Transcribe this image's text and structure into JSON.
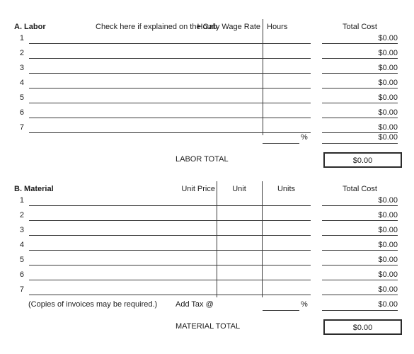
{
  "form": {
    "background_color": "#ffffff",
    "rule_color": "#3a3a3a",
    "box_border_color": "#2b2b2b",
    "text_color": "#1d1d1d"
  },
  "labor": {
    "section_title": "A. Labor",
    "check_note": "Check here if explained on the Cab",
    "columns": {
      "hourly_wage_rate": "Hourly Wage Rate",
      "hours": "Hours",
      "total_cost": "Total Cost"
    },
    "row_numbers": [
      "1",
      "2",
      "3",
      "4",
      "5",
      "6",
      "7"
    ],
    "total_costs": [
      "$0.00",
      "$0.00",
      "$0.00",
      "$0.00",
      "$0.00",
      "$0.00",
      "$0.00"
    ],
    "percent_symbol": "%",
    "percent_row_total": "$0.00",
    "total_label": "LABOR TOTAL",
    "total_value": "$0.00"
  },
  "material": {
    "section_title": "B. Material",
    "columns": {
      "unit_price": "Unit Price",
      "unit": "Unit",
      "units": "Units",
      "total_cost": "Total Cost"
    },
    "row_numbers": [
      "1",
      "2",
      "3",
      "4",
      "5",
      "6",
      "7"
    ],
    "total_costs": [
      "$0.00",
      "$0.00",
      "$0.00",
      "$0.00",
      "$0.00",
      "$0.00",
      "$0.00"
    ],
    "invoice_note": "(Copies of invoices may be required.)",
    "add_tax_label": "Add Tax @",
    "percent_symbol": "%",
    "tax_row_total": "$0.00",
    "total_label": "MATERIAL TOTAL",
    "total_value": "$0.00"
  }
}
